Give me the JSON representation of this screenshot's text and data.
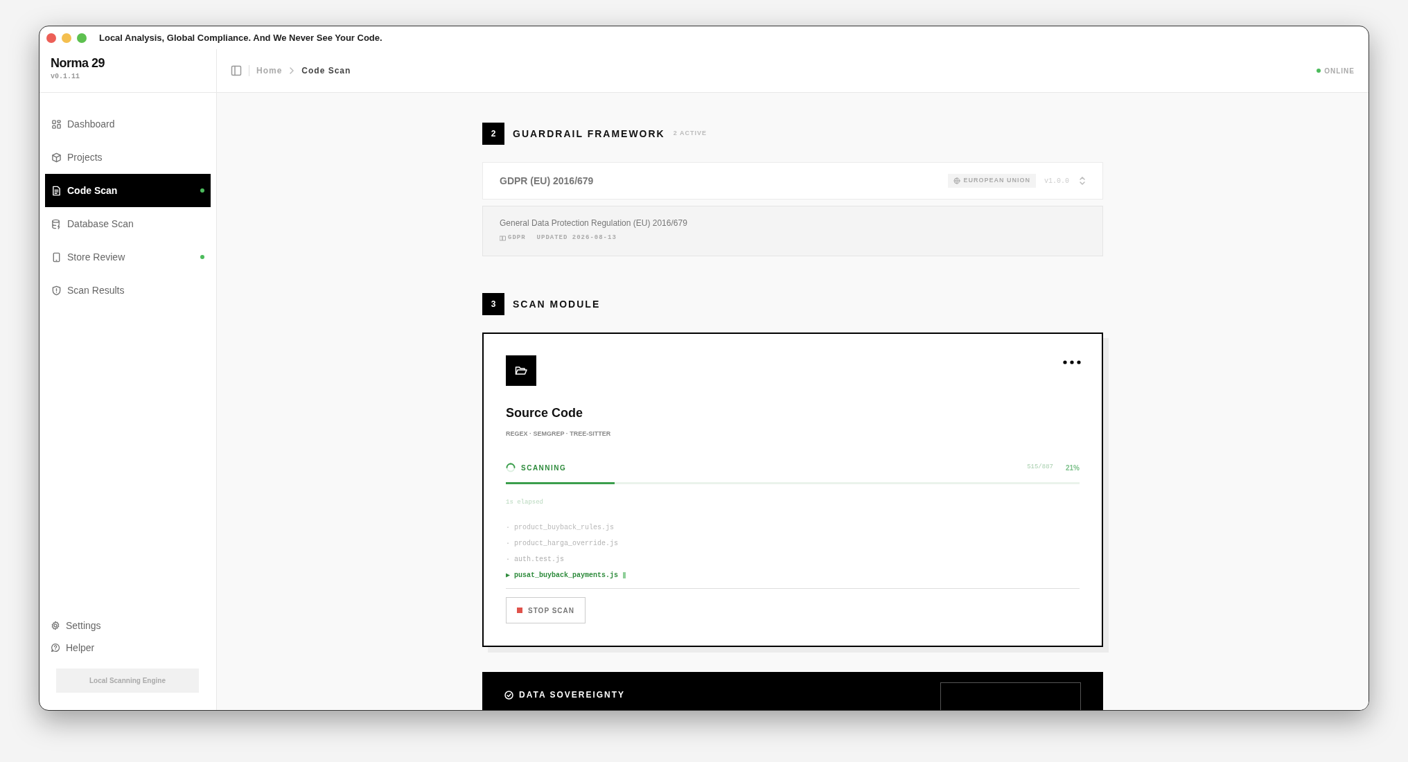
{
  "window": {
    "title": "Local Analysis, Global Compliance. And We Never See Your Code."
  },
  "sidebar": {
    "brand": "Norma 29",
    "version": "v0.1.11",
    "items": [
      {
        "label": "Dashboard",
        "selected": false,
        "indicator": false
      },
      {
        "label": "Projects",
        "selected": false,
        "indicator": false
      },
      {
        "label": "Code Scan",
        "selected": true,
        "indicator": true
      },
      {
        "label": "Database Scan",
        "selected": false,
        "indicator": false
      },
      {
        "label": "Store Review",
        "selected": false,
        "indicator": true
      },
      {
        "label": "Scan Results",
        "selected": false,
        "indicator": false
      }
    ],
    "footer_items": [
      {
        "label": "Settings"
      },
      {
        "label": "Helper"
      }
    ],
    "engine_button": "Local Scanning Engine"
  },
  "header": {
    "breadcrumb": [
      "Home",
      "Code Scan"
    ],
    "status": "ONLINE"
  },
  "guardrail": {
    "number": "2",
    "title": "GUARDRAIL FRAMEWORK",
    "count": "2 ACTIVE",
    "framework": {
      "name": "GDPR (EU) 2016/679",
      "region": "EUROPEAN UNION",
      "version": "v1.0.0"
    },
    "detail": {
      "description": "General Data Protection Regulation (EU) 2016/679",
      "code": "GDPR",
      "updated": "UPDATED 2026-08-13"
    }
  },
  "scan_module": {
    "number": "3",
    "title": "SCAN MODULE",
    "card": {
      "title": "Source Code",
      "engines": "REGEX · SEMGREP · TREE-SITTER",
      "status": "SCANNING",
      "progress": "515/887",
      "percent": "21%",
      "level": 0.19,
      "elapsed": "1s elapsed",
      "files": [
        {
          "marker": "·",
          "name": "product_buyback_rules.js",
          "current": false
        },
        {
          "marker": "·",
          "name": "product_harga_override.js",
          "current": false
        },
        {
          "marker": "·",
          "name": "auth.test.js",
          "current": false
        },
        {
          "marker": "▶",
          "name": "pusat_buyback_payments.js",
          "current": true
        }
      ],
      "stop_button": "STOP SCAN"
    }
  },
  "data_sovereignty": {
    "title": "DATA SOVEREIGNTY"
  }
}
